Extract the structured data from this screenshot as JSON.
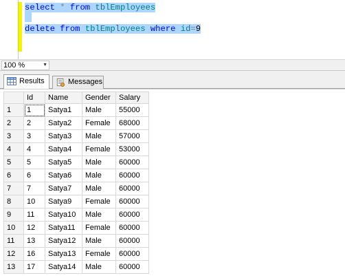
{
  "editor": {
    "line1": {
      "kw1": "select",
      "star": " * ",
      "kw2": "from",
      "table": " tblEmployees"
    },
    "line3": {
      "kw1": "delete",
      "kw2": " from",
      "table": " tblEmployees",
      "kw3": " where",
      "col": " id",
      "op": "=",
      "val": "9"
    }
  },
  "zoom": {
    "value": "100 %"
  },
  "tabs": {
    "results": "Results",
    "messages": "Messages"
  },
  "grid": {
    "headers": [
      "Id",
      "Name",
      "Gender",
      "Salary"
    ],
    "rows": [
      [
        "1",
        "1",
        "Satya1",
        "Male",
        "55000"
      ],
      [
        "2",
        "2",
        "Satya2",
        "Female",
        "68000"
      ],
      [
        "3",
        "3",
        "Satya3",
        "Male",
        "57000"
      ],
      [
        "4",
        "4",
        "Satya4",
        "Female",
        "53000"
      ],
      [
        "5",
        "5",
        "Satya5",
        "Male",
        "60000"
      ],
      [
        "6",
        "6",
        "Satya6",
        "Male",
        "60000"
      ],
      [
        "7",
        "7",
        "Satya7",
        "Male",
        "60000"
      ],
      [
        "8",
        "10",
        "Satya9",
        "Female",
        "60000"
      ],
      [
        "9",
        "11",
        "Satya10",
        "Male",
        "60000"
      ],
      [
        "10",
        "12",
        "Satya11",
        "Female",
        "60000"
      ],
      [
        "11",
        "13",
        "Satya12",
        "Male",
        "60000"
      ],
      [
        "12",
        "16",
        "Satya13",
        "Female",
        "60000"
      ],
      [
        "13",
        "17",
        "Satya14",
        "Male",
        "60000"
      ]
    ]
  }
}
